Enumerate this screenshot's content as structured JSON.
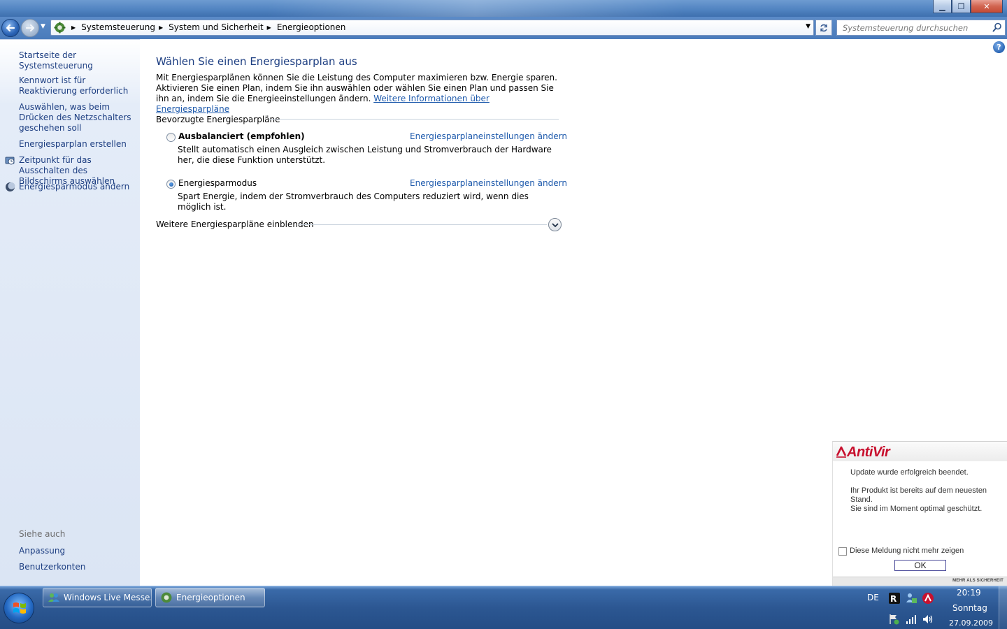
{
  "window": {
    "minimize_glyph": "▁",
    "maximize_glyph": "❐",
    "close_glyph": "✕"
  },
  "navigation": {
    "breadcrumbs": [
      "Systemsteuerung",
      "System und Sicherheit",
      "Energieoptionen"
    ],
    "search_placeholder": "Systemsteuerung durchsuchen"
  },
  "sidebar": {
    "home_link": "Startseite der Systemsteuerung",
    "links": [
      "Kennwort ist für Reaktivierung erforderlich",
      "Auswählen, was beim Drücken des Netzschalters geschehen soll",
      "Energiesparplan erstellen",
      "Zeitpunkt für das Ausschalten des Bildschirms auswählen",
      "Energiesparmodus ändern"
    ],
    "see_also_heading": "Siehe auch",
    "see_also_links": [
      "Anpassung",
      "Benutzerkonten"
    ]
  },
  "main": {
    "title": "Wählen Sie einen Energiesparplan aus",
    "intro": "Mit Energiesparplänen können Sie die Leistung des Computer maximieren bzw. Energie sparen. Aktivieren Sie einen Plan, indem Sie ihn auswählen oder wählen Sie einen Plan und passen Sie ihn an, indem Sie die Energieeinstellungen ändern.",
    "intro_link": "Weitere Informationen über Energiesparpläne",
    "group_label": "Bevorzugte Energiesparpläne",
    "plans": [
      {
        "name": "Ausbalanciert (empfohlen)",
        "selected": false,
        "link": "Energiesparplaneinstellungen ändern",
        "description": "Stellt automatisch einen Ausgleich zwischen Leistung und Stromverbrauch der Hardware her, die diese Funktion unterstützt."
      },
      {
        "name": "Energiesparmodus",
        "selected": true,
        "link": "Energiesparplaneinstellungen ändern",
        "description": "Spart Energie, indem der Stromverbrauch des Computers reduziert wird, wenn dies möglich ist."
      }
    ],
    "more_plans_label": "Weitere Energiesparpläne einblenden"
  },
  "antivir": {
    "logo": "AntiVir",
    "line1": "Update wurde erfolgreich beendet.",
    "line2": "Ihr Produkt ist bereits auf dem neuesten Stand.",
    "line3": "Sie sind im Moment optimal geschützt.",
    "checkbox_label": "Diese Meldung nicht mehr zeigen",
    "ok_label": "OK",
    "slogan": "MEHR ALS SICHERHEIT"
  },
  "taskbar": {
    "buttons": [
      "Windows Live Messe...",
      "Energieoptionen"
    ],
    "language": "DE",
    "time": "20:19",
    "day": "Sonntag",
    "date": "27.09.2009"
  }
}
